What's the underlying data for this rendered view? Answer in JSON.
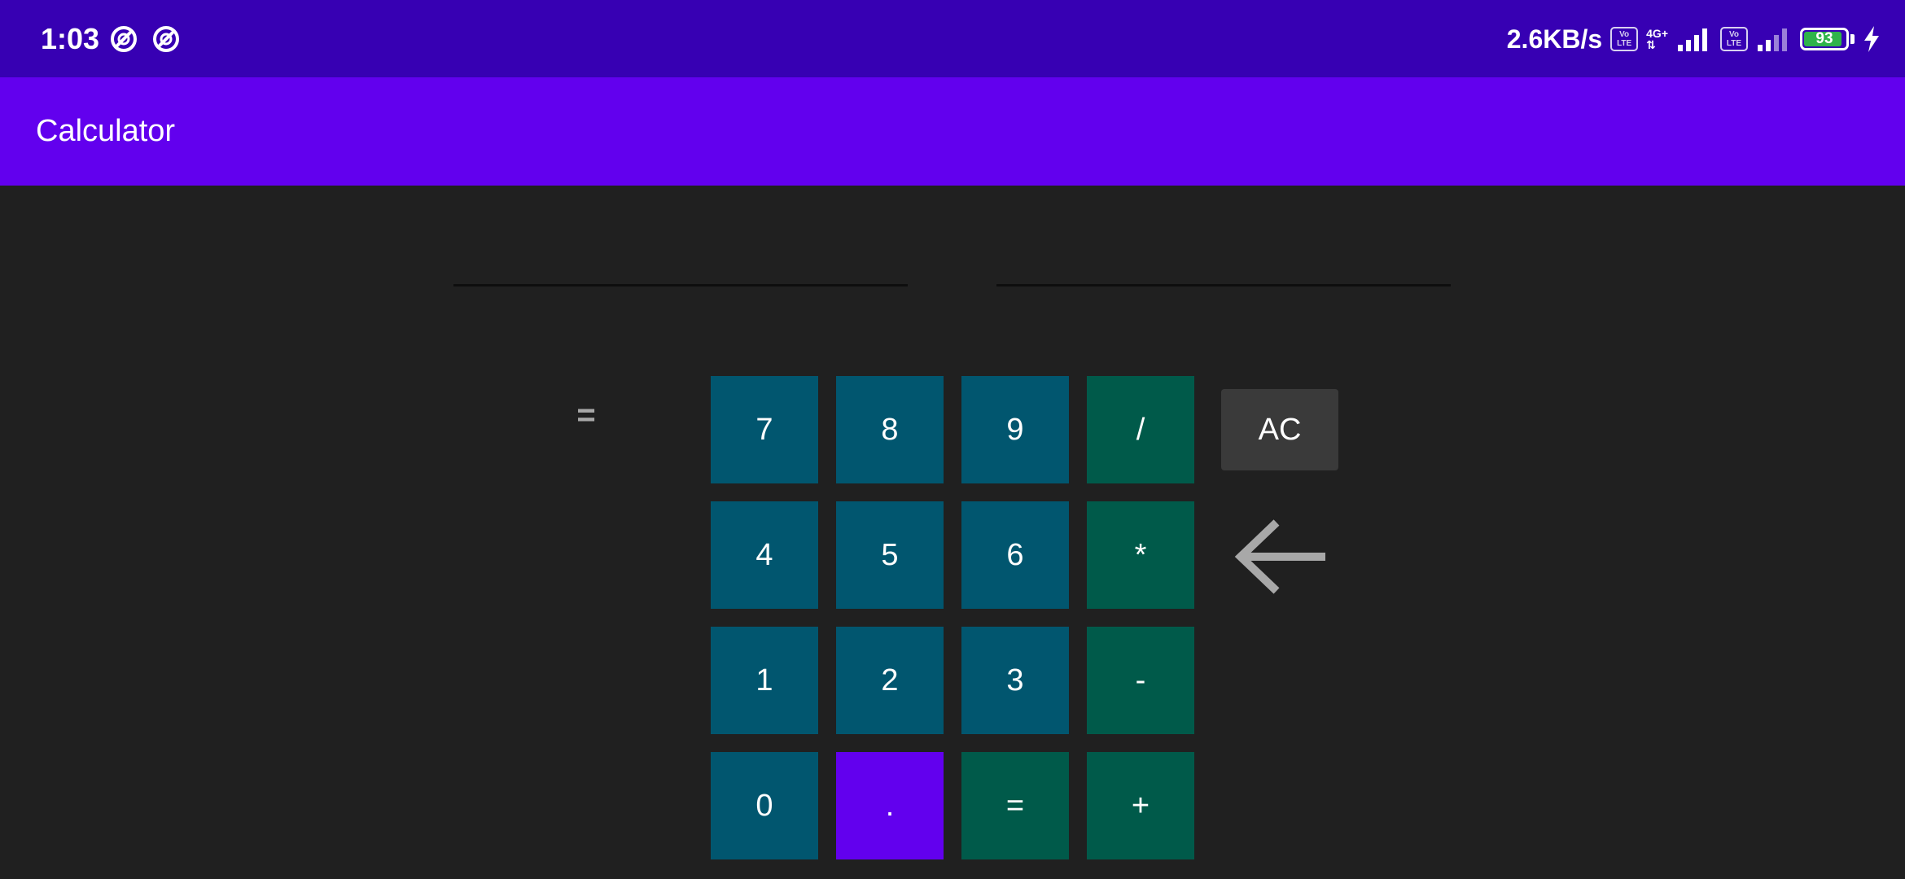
{
  "status_bar": {
    "time": "1:03",
    "net_speed": "2.6KB/s",
    "volte_label_top": "Vo",
    "volte_label_bottom": "LTE",
    "network_type": "4G+",
    "battery_level": "93",
    "battery_fraction": 0.93,
    "icons": [
      "notification-icon",
      "notification-icon",
      "volte-icon",
      "signal-icon",
      "volte-icon",
      "signal-icon",
      "battery-icon",
      "charging-icon"
    ]
  },
  "app_bar": {
    "title": "Calculator"
  },
  "inputs": {
    "first_operand": "",
    "second_operand": ""
  },
  "result": {
    "equals_sign": "=",
    "value": ""
  },
  "keypad": {
    "rows": [
      [
        "7",
        "8",
        "9",
        "/"
      ],
      [
        "4",
        "5",
        "6",
        "*"
      ],
      [
        "1",
        "2",
        "3",
        "-"
      ],
      [
        "0",
        ".",
        "=",
        "+"
      ]
    ],
    "clear_label": "AC",
    "backspace_icon": "arrow-left-icon"
  },
  "colors": {
    "status_bar": "#3700B3",
    "app_bar": "#6200EE",
    "background": "#202020",
    "number_key": "#01566F",
    "operator_key": "#005A4A",
    "dot_key": "#6200EE",
    "clear_key": "#3A3A3A",
    "backspace_icon": "#A8A8A8"
  }
}
